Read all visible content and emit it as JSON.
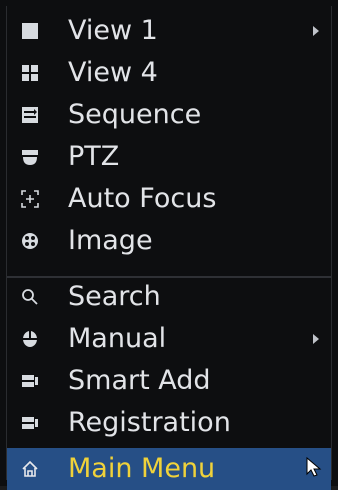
{
  "menu": {
    "items": [
      {
        "label": "View 1",
        "icon": "single-view-icon",
        "submenu": true
      },
      {
        "label": "View 4",
        "icon": "quad-view-icon",
        "submenu": false
      },
      {
        "label": "Sequence",
        "icon": "sequence-icon",
        "submenu": false
      },
      {
        "label": "PTZ",
        "icon": "ptz-icon",
        "submenu": false
      },
      {
        "label": "Auto Focus",
        "icon": "auto-focus-icon",
        "submenu": false
      },
      {
        "label": "Image",
        "icon": "image-icon",
        "submenu": false
      },
      {
        "label": "Search",
        "icon": "search-icon",
        "submenu": false
      },
      {
        "label": "Manual",
        "icon": "manual-icon",
        "submenu": true
      },
      {
        "label": "Smart Add",
        "icon": "smart-add-icon",
        "submenu": false
      },
      {
        "label": "Registration",
        "icon": "registration-icon",
        "submenu": false
      },
      {
        "label": "Main Menu",
        "icon": "home-icon",
        "submenu": false,
        "selected": true
      }
    ]
  },
  "colors": {
    "background": "#0d0e10",
    "text": "#e2e4e8",
    "selected_bg": "#264f86",
    "selected_text": "#f0d23a"
  }
}
